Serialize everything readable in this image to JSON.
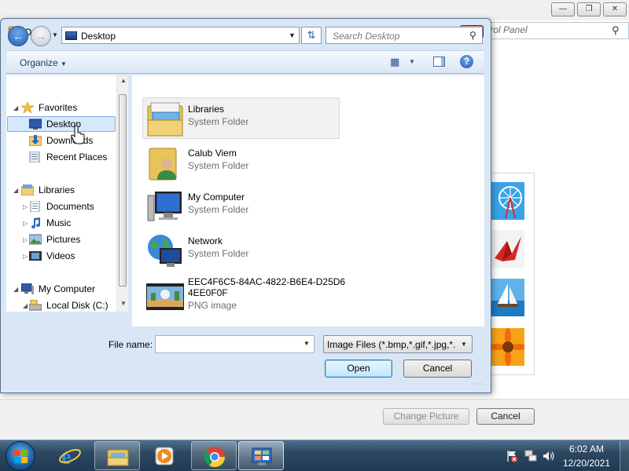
{
  "background_window": {
    "search_placeholder": "Search Control Panel",
    "search_visible": "trol Panel",
    "change_picture_label": "Change Picture",
    "cancel_label": "Cancel"
  },
  "dialog": {
    "title": "Open",
    "address": "Desktop",
    "search_placeholder": "Search Desktop",
    "organize_label": "Organize",
    "nav_tree": [
      {
        "label": "Favorites",
        "icon": "star-icon"
      },
      {
        "label": "Desktop",
        "icon": "desktop-icon"
      },
      {
        "label": "Downloads",
        "icon": "downloads-folder-icon"
      },
      {
        "label": "Recent Places",
        "icon": "recent-places-icon"
      },
      {
        "label": "Libraries",
        "icon": "libraries-icon"
      },
      {
        "label": "Documents",
        "icon": "documents-icon"
      },
      {
        "label": "Music",
        "icon": "music-icon"
      },
      {
        "label": "Pictures",
        "icon": "pictures-icon"
      },
      {
        "label": "Videos",
        "icon": "videos-icon"
      },
      {
        "label": "My Computer",
        "icon": "computer-icon"
      },
      {
        "label": "Local Disk (C:)",
        "icon": "disk-icon"
      }
    ],
    "files": [
      {
        "name": "Libraries",
        "type": "System Folder",
        "icon": "libraries-folder-icon"
      },
      {
        "name": "Calub Viem",
        "type": "System Folder",
        "icon": "user-folder-icon"
      },
      {
        "name": "My Computer",
        "type": "System Folder",
        "icon": "computer-icon"
      },
      {
        "name": "Network",
        "type": "System Folder",
        "icon": "network-icon"
      },
      {
        "name": "EEC4F6C5-84AC-4822-B6E4-D25D6",
        "name_line2": "4EE0F0F",
        "type": "PNG image",
        "icon": "png-thumbnail-icon"
      }
    ],
    "file_name_label": "File name:",
    "file_name_value": "",
    "file_type_value": "Image Files (*.bmp,*.gif,*.jpg,*.",
    "open_label": "Open",
    "cancel_label": "Cancel"
  },
  "taskbar": {
    "clock_time": "6:02 AM",
    "clock_date": "12/20/2021"
  },
  "colors": {
    "dialog_frame": "#d9e6f5",
    "selection": "#d6e8fb",
    "taskbar": "#2c4760",
    "close_button": "#c9462b"
  }
}
